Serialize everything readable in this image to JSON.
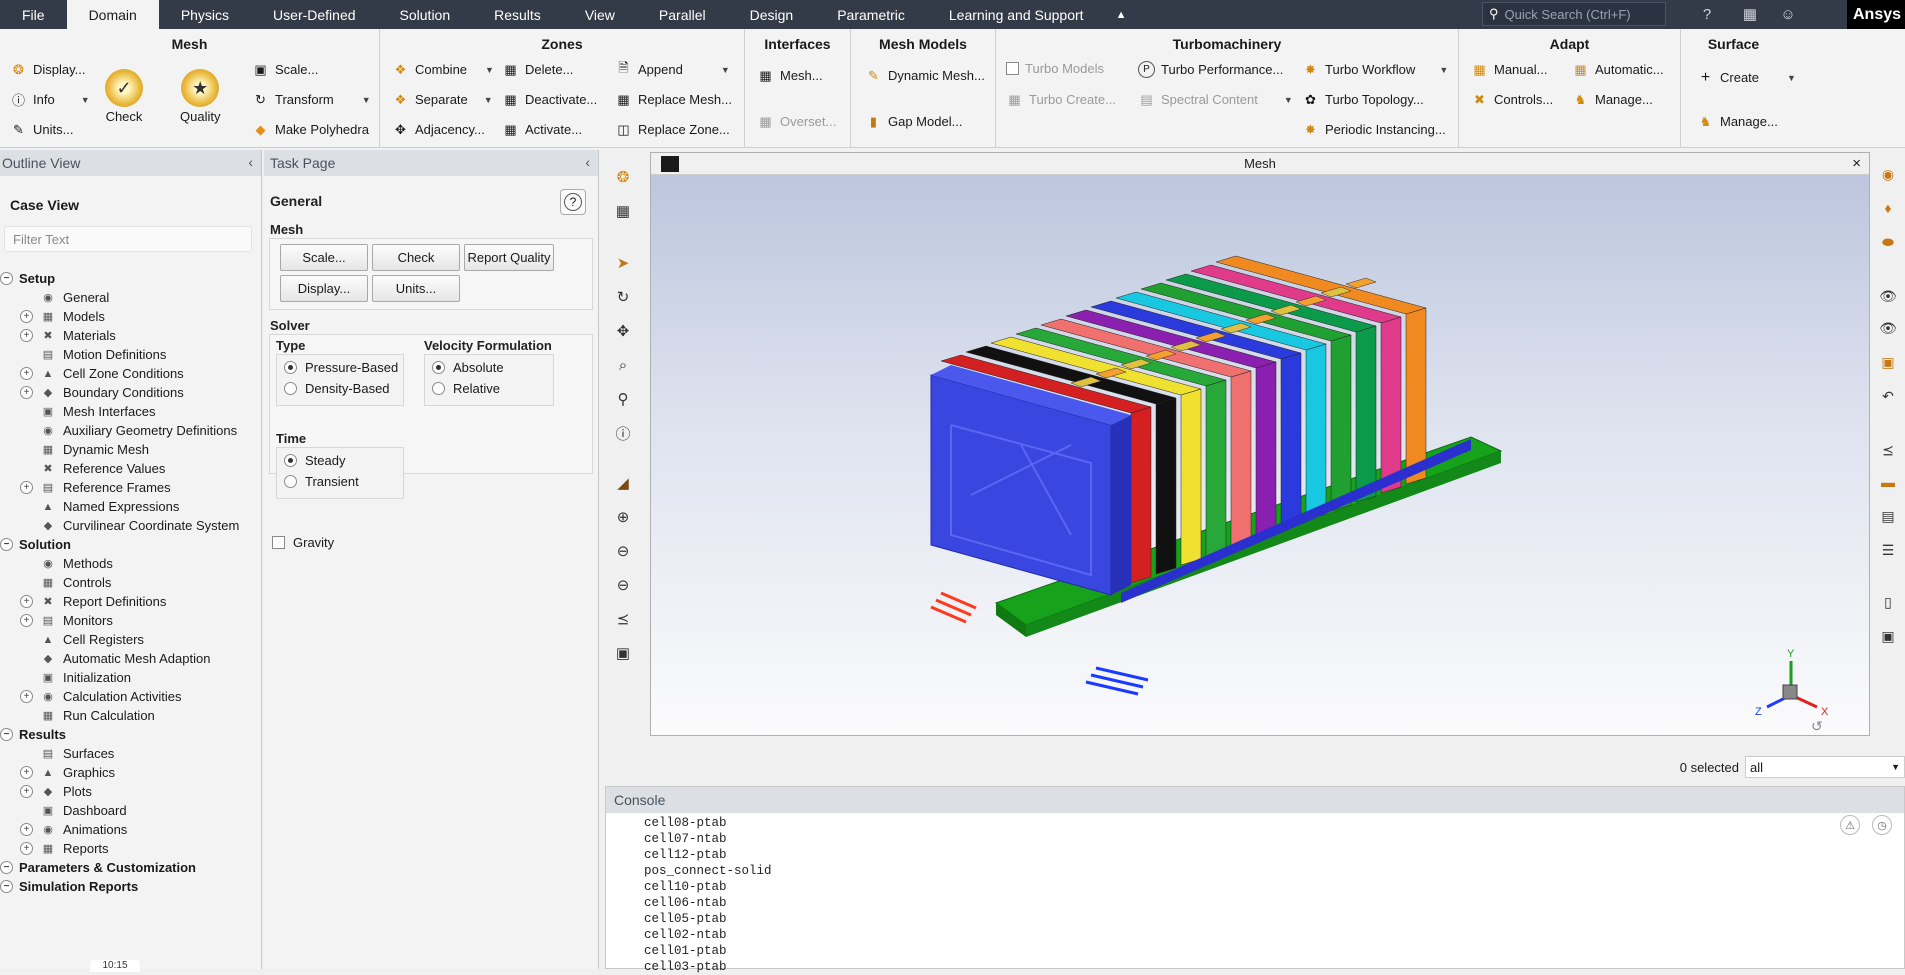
{
  "menubar": {
    "items": [
      "File",
      "Domain",
      "Physics",
      "User-Defined",
      "Solution",
      "Results",
      "View",
      "Parallel",
      "Design",
      "Parametric",
      "Learning and Support"
    ],
    "caret": "▲",
    "search_placeholder": "Quick Search (Ctrl+F)",
    "brand": "Ansys"
  },
  "ribbon": {
    "mesh": {
      "title": "Mesh",
      "display": "Display...",
      "info": "Info",
      "units": "Units...",
      "check": "Check",
      "quality": "Quality",
      "scale": "Scale...",
      "transform": "Transform",
      "make_polyhedra": "Make Polyhedra"
    },
    "zones": {
      "title": "Zones",
      "combine": "Combine",
      "separate": "Separate",
      "adjacency": "Adjacency...",
      "delete": "Delete...",
      "deactivate": "Deactivate...",
      "activate": "Activate...",
      "append": "Append",
      "replace_mesh": "Replace Mesh...",
      "replace_zone": "Replace Zone..."
    },
    "interfaces": {
      "title": "Interfaces",
      "mesh": "Mesh...",
      "overset": "Overset..."
    },
    "mesh_models": {
      "title": "Mesh Models",
      "dynamic_mesh": "Dynamic Mesh...",
      "gap_model": "Gap Model..."
    },
    "turbo": {
      "title": "Turbomachinery",
      "turbo_models": "Turbo Models",
      "turbo_create": "Turbo Create...",
      "turbo_performance": "Turbo Performance...",
      "spectral_content": "Spectral Content",
      "turbo_workflow": "Turbo Workflow",
      "turbo_topology": "Turbo Topology...",
      "periodic_instancing": "Periodic Instancing..."
    },
    "adapt": {
      "title": "Adapt",
      "manual": "Manual...",
      "controls": "Controls...",
      "automatic": "Automatic...",
      "manage": "Manage..."
    },
    "surface": {
      "title": "Surface",
      "create": "Create",
      "manage": "Manage..."
    }
  },
  "outline": {
    "title": "Outline View",
    "case_view": "Case View",
    "filter_placeholder": "Filter Text",
    "tree": [
      {
        "label": "Setup",
        "level": 0,
        "section": true
      },
      {
        "label": "General",
        "level": 1
      },
      {
        "label": "Models",
        "level": 1,
        "exp": true
      },
      {
        "label": "Materials",
        "level": 1,
        "exp": true
      },
      {
        "label": "Motion Definitions",
        "level": 1
      },
      {
        "label": "Cell Zone Conditions",
        "level": 1,
        "exp": true
      },
      {
        "label": "Boundary Conditions",
        "level": 1,
        "exp": true
      },
      {
        "label": "Mesh Interfaces",
        "level": 1
      },
      {
        "label": "Auxiliary Geometry Definitions",
        "level": 1
      },
      {
        "label": "Dynamic Mesh",
        "level": 1
      },
      {
        "label": "Reference Values",
        "level": 1
      },
      {
        "label": "Reference Frames",
        "level": 1,
        "exp": true
      },
      {
        "label": "Named Expressions",
        "level": 1
      },
      {
        "label": "Curvilinear Coordinate System",
        "level": 1
      },
      {
        "label": "Solution",
        "level": 0,
        "section": true
      },
      {
        "label": "Methods",
        "level": 1
      },
      {
        "label": "Controls",
        "level": 1
      },
      {
        "label": "Report Definitions",
        "level": 1,
        "exp": true
      },
      {
        "label": "Monitors",
        "level": 1,
        "exp": true
      },
      {
        "label": "Cell Registers",
        "level": 1
      },
      {
        "label": "Automatic Mesh Adaption",
        "level": 1
      },
      {
        "label": "Initialization",
        "level": 1
      },
      {
        "label": "Calculation Activities",
        "level": 1,
        "exp": true
      },
      {
        "label": "Run Calculation",
        "level": 1
      },
      {
        "label": "Results",
        "level": 0,
        "section": true
      },
      {
        "label": "Surfaces",
        "level": 1
      },
      {
        "label": "Graphics",
        "level": 1,
        "exp": true
      },
      {
        "label": "Plots",
        "level": 1,
        "exp": true
      },
      {
        "label": "Dashboard",
        "level": 1
      },
      {
        "label": "Animations",
        "level": 1,
        "exp": true
      },
      {
        "label": "Reports",
        "level": 1,
        "exp": true
      },
      {
        "label": "Parameters & Customization",
        "level": 0,
        "section": true
      },
      {
        "label": "Simulation Reports",
        "level": 0,
        "section": true
      }
    ]
  },
  "task": {
    "title": "Task Page",
    "general": "General",
    "help": "?",
    "mesh_label": "Mesh",
    "btn_scale": "Scale...",
    "btn_check": "Check",
    "btn_report_quality": "Report Quality",
    "btn_display": "Display...",
    "btn_units": "Units...",
    "solver_label": "Solver",
    "type_label": "Type",
    "pressure_based": "Pressure-Based",
    "density_based": "Density-Based",
    "velocity_label": "Velocity Formulation",
    "absolute": "Absolute",
    "relative": "Relative",
    "time_label": "Time",
    "steady": "Steady",
    "transient": "Transient",
    "gravity": "Gravity"
  },
  "viewport": {
    "title": "Mesh",
    "close": "×",
    "axis_x": "X",
    "axis_y": "Y",
    "axis_z": "Z"
  },
  "selection": {
    "count": "0 selected",
    "filter": "all"
  },
  "console": {
    "title": "Console",
    "lines": [
      "cell08-ptab",
      "cell07-ntab",
      "cell12-ptab",
      "pos_connect-solid",
      "cell10-ptab",
      "cell06-ntab",
      "cell05-ptab",
      "cell02-ntab",
      "cell01-ptab",
      "cell03-ptab"
    ]
  },
  "clock": "10:15"
}
